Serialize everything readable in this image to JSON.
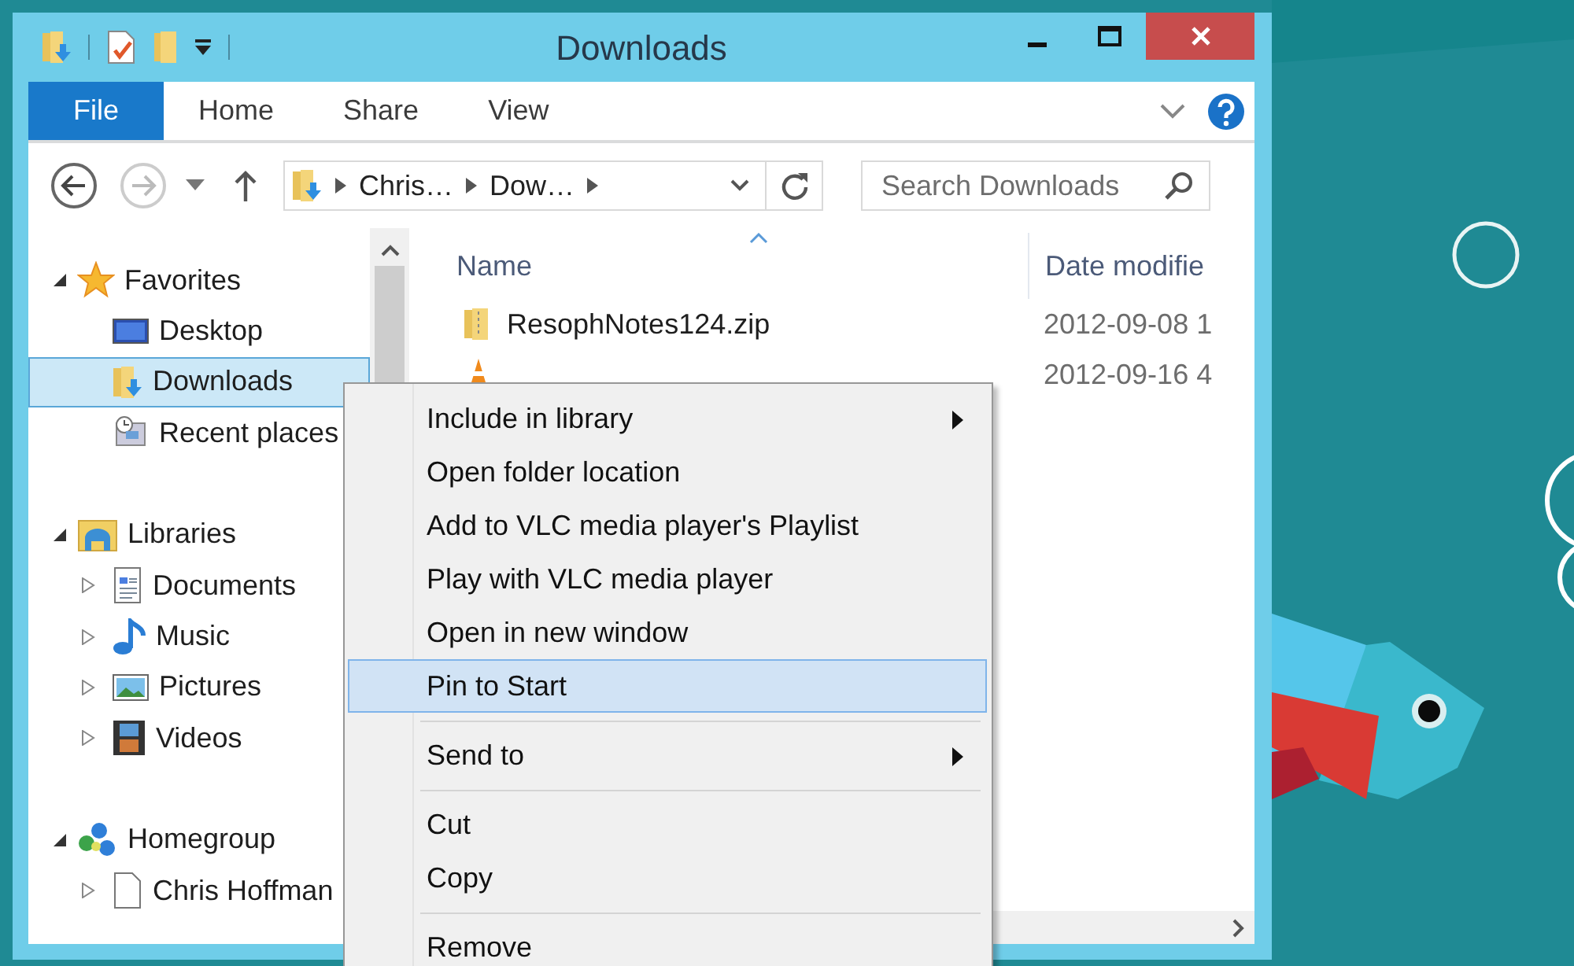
{
  "window": {
    "title": "Downloads"
  },
  "ribbon": {
    "tabs": [
      {
        "label": "File",
        "kind": "file",
        "selected": false
      },
      {
        "label": "Home",
        "kind": "tab",
        "selected": false
      },
      {
        "label": "Share",
        "kind": "tab",
        "selected": false
      },
      {
        "label": "View",
        "kind": "tab",
        "selected": false
      }
    ]
  },
  "address": {
    "crumbs": [
      "Chris…",
      "Dow…"
    ]
  },
  "search": {
    "placeholder": "Search Downloads"
  },
  "navigation": [
    {
      "label": "Favorites",
      "kind": "star",
      "expanded": true,
      "children": [
        {
          "label": "Desktop",
          "kind": "desktop",
          "selected": false
        },
        {
          "label": "Downloads",
          "kind": "downloads",
          "selected": true
        },
        {
          "label": "Recent places",
          "kind": "recent",
          "selected": false
        }
      ]
    },
    {
      "label": "Libraries",
      "kind": "libraries",
      "expanded": true,
      "children": [
        {
          "label": "Documents",
          "kind": "documents",
          "expanded": false,
          "selected": false
        },
        {
          "label": "Music",
          "kind": "music",
          "expanded": false,
          "selected": false
        },
        {
          "label": "Pictures",
          "kind": "pictures",
          "expanded": false,
          "selected": false
        },
        {
          "label": "Videos",
          "kind": "videos",
          "expanded": false,
          "selected": false
        }
      ]
    },
    {
      "label": "Homegroup",
      "kind": "homegroup",
      "expanded": true,
      "children": [
        {
          "label": "Chris Hoffman",
          "kind": "user",
          "expanded": false,
          "selected": false
        }
      ]
    }
  ],
  "files": {
    "columns": [
      {
        "label": "Name",
        "sorted": true
      },
      {
        "label": "Date modifie",
        "sorted": false
      }
    ],
    "rows": [
      {
        "name": "ResophNotes124.zip",
        "kind": "zip",
        "date": "2012-09-08 1"
      },
      {
        "kind": "installer",
        "date": "2012-09-16 4"
      }
    ]
  },
  "context_menu": {
    "items": [
      {
        "kind": "item",
        "label": "Include in library",
        "submenu": true,
        "selected": false
      },
      {
        "kind": "item",
        "label": "Open folder location",
        "submenu": false,
        "selected": false
      },
      {
        "kind": "item",
        "label": "Add to VLC media player's Playlist",
        "submenu": false,
        "selected": false
      },
      {
        "kind": "item",
        "label": "Play with VLC media player",
        "submenu": false,
        "selected": false
      },
      {
        "kind": "item",
        "label": "Open in new window",
        "submenu": false,
        "selected": false
      },
      {
        "kind": "item",
        "label": "Pin to Start",
        "submenu": false,
        "selected": true
      },
      {
        "kind": "separator"
      },
      {
        "kind": "item",
        "label": "Send to",
        "submenu": true,
        "selected": false
      },
      {
        "kind": "separator"
      },
      {
        "kind": "item",
        "label": "Cut",
        "submenu": false,
        "selected": false
      },
      {
        "kind": "item",
        "label": "Copy",
        "submenu": false,
        "selected": false
      },
      {
        "kind": "separator"
      },
      {
        "kind": "item",
        "label": "Remove",
        "submenu": false,
        "selected": false
      }
    ]
  }
}
